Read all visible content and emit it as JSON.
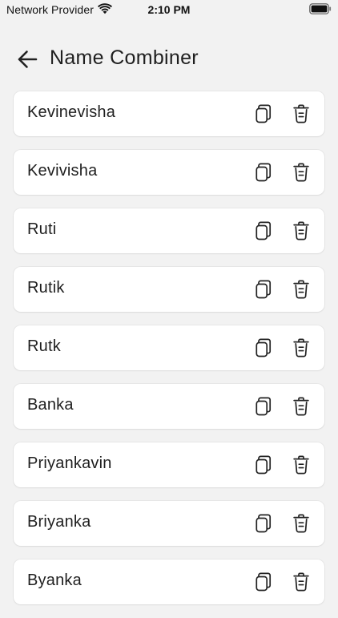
{
  "status_bar": {
    "carrier": "Network Provider",
    "time": "2:10 PM",
    "wifi_icon": "wifi-icon",
    "battery_icon": "battery-icon"
  },
  "header": {
    "back_icon": "arrow-left-icon",
    "title": "Name Combiner"
  },
  "list": {
    "copy_icon": "copy-icon",
    "delete_icon": "trash-icon",
    "items": [
      {
        "name": "Kevinevisha"
      },
      {
        "name": "Kevivisha"
      },
      {
        "name": "Ruti"
      },
      {
        "name": "Rutik"
      },
      {
        "name": "Rutk"
      },
      {
        "name": "Banka"
      },
      {
        "name": "Priyankavin"
      },
      {
        "name": "Briyanka"
      },
      {
        "name": "Byanka"
      }
    ]
  }
}
